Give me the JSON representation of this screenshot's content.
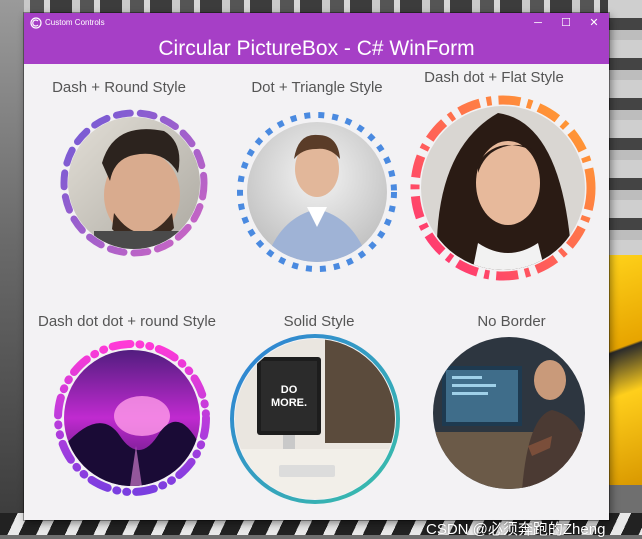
{
  "window": {
    "title": "Custom Controls",
    "controls": {
      "minimize": "─",
      "maximize": "☐",
      "close": "✕"
    }
  },
  "header": {
    "title": "Circular PictureBox - C# WinForm"
  },
  "items": [
    {
      "label": "Dash + Round Style",
      "photo": "man-portrait-photo",
      "border": "dash-round"
    },
    {
      "label": "Dot + Triangle Style",
      "photo": "man-in-shirt-photo",
      "border": "dot-triangle"
    },
    {
      "label": "Dash dot + Flat Style",
      "photo": "woman-portrait-photo",
      "border": "dashdot-flat"
    },
    {
      "label": "Dash dot dot + round Style",
      "photo": "purple-landscape-photo",
      "border": "dashdotdot-round"
    },
    {
      "label": "Solid Style",
      "photo": "desk-setup-photo",
      "border": "solid"
    },
    {
      "label": "No Border",
      "photo": "programmer-photo",
      "border": "none"
    }
  ],
  "colors": {
    "accent": "#a63fc6",
    "dash_round": [
      "#7b5bd0",
      "#c45fc0"
    ],
    "dot_triangle": "#4a8ae0",
    "dashdot_flat": [
      "#ff2d7a",
      "#ffa52a"
    ],
    "dashdotdot": [
      "#ff3ad7",
      "#7a3ee0"
    ],
    "solid": [
      "#2f7fd8",
      "#39c0a8"
    ]
  },
  "watermark": "CSDN @必须奔跑的Zheng"
}
